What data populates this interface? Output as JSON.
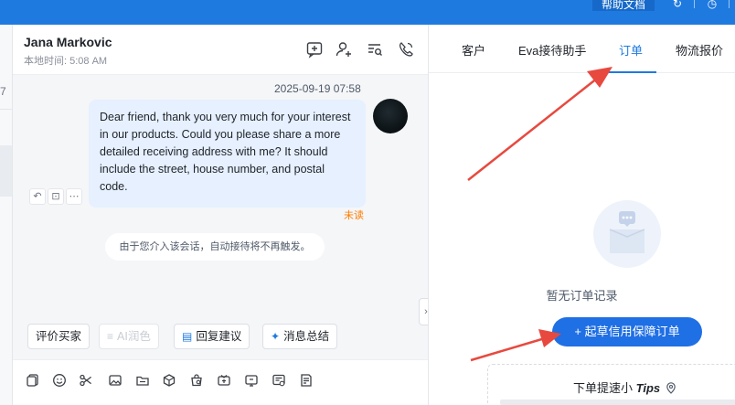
{
  "topbar": {
    "help_label": "帮助文档",
    "icons": [
      "refresh-icon",
      "clock-icon"
    ],
    "accent": "#1f7ae0"
  },
  "leftstrip": {
    "mark": "7"
  },
  "chat": {
    "contact_name": "Jana Markovic",
    "local_time": "本地时间: 5:08 AM",
    "header_icons": [
      "add-note-icon",
      "user-add-icon",
      "search-list-icon",
      "phone-icon"
    ],
    "message": {
      "timestamp": "2025-09-19 07:58",
      "text": "Dear friend, thank you very much for your interest in our products. Could you please share a more detailed receiving address with me? It should include the street, house number, and postal code.",
      "status": "未读"
    },
    "system_notice": "由于您介入该会话，自动接待将不再触发。",
    "quick_actions": [
      {
        "label": "评价买家",
        "icon": "",
        "disabled": false
      },
      {
        "label": "AI润色",
        "icon": "≡",
        "disabled": true
      },
      {
        "label": "回复建议",
        "icon": "▤",
        "disabled": false
      },
      {
        "label": "消息总结",
        "icon": "✦",
        "disabled": false
      }
    ],
    "toolbar_icons": [
      "copy-icon",
      "emoji-icon",
      "scissors-icon",
      "image-icon",
      "folder-icon",
      "product-icon",
      "order-icon",
      "coupon-icon",
      "screenshot-icon",
      "invoice-icon",
      "note-icon"
    ]
  },
  "right": {
    "tabs": [
      "客户",
      "Eva接待助手",
      "订单",
      "物流报价"
    ],
    "active_tab": "订单",
    "empty_text": "暂无订单记录",
    "draft_button": "+ 起草信用保障订单",
    "tips_title": "下单提速小",
    "tips_italic": "Tips"
  },
  "colors": {
    "primary": "#1f6fe5",
    "unread": "#ff7d00",
    "bubble": "#e6f0ff",
    "annotation_arrow": "#e8493f"
  }
}
